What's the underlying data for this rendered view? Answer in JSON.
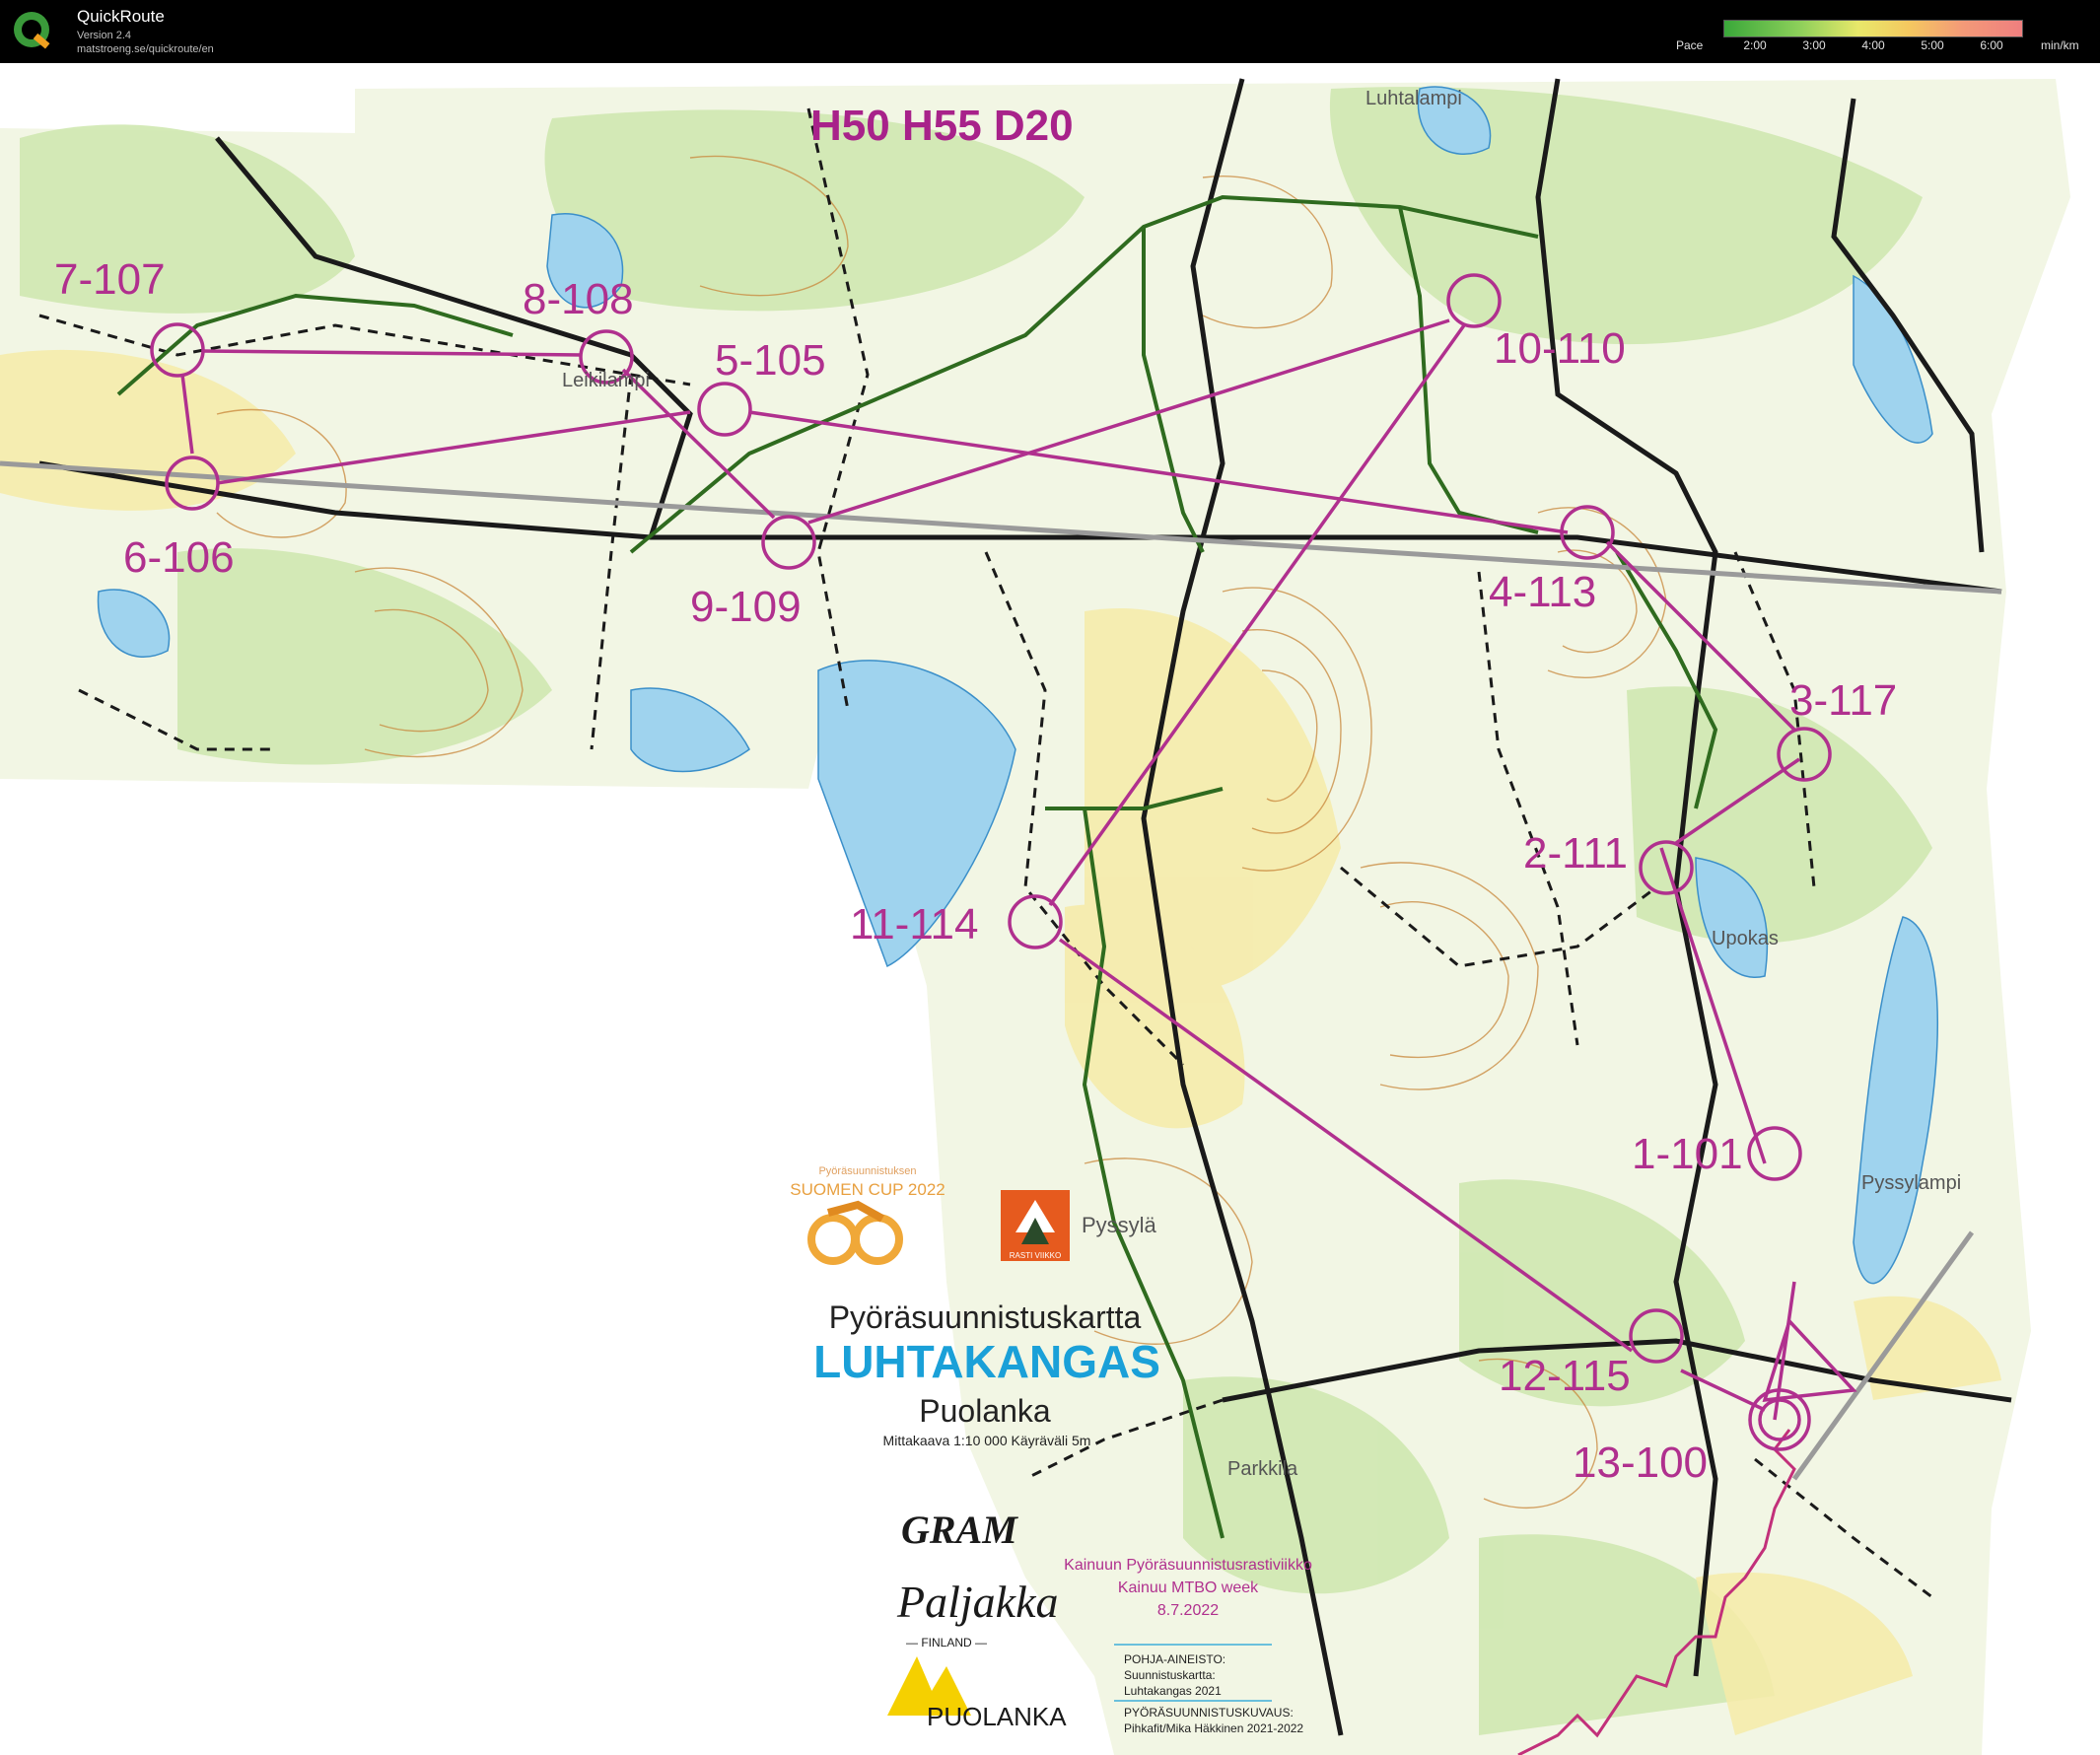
{
  "app": {
    "title": "QuickRoute",
    "version": "Version 2.4",
    "url": "matstroeng.se/quickroute/en"
  },
  "pace_legend": {
    "label": "Pace",
    "ticks": [
      "2:00",
      "3:00",
      "4:00",
      "5:00",
      "6:00"
    ],
    "unit": "min/km"
  },
  "map": {
    "course_title": "H50 H55 D20",
    "place_names": [
      "Luhtalampi",
      "Leikilampi",
      "Upokas",
      "Pyssylampi",
      "Parkkila",
      "Pyssylä"
    ],
    "controls": [
      {
        "label": "1-101"
      },
      {
        "label": "2-111"
      },
      {
        "label": "3-117"
      },
      {
        "label": "4-113"
      },
      {
        "label": "5-105"
      },
      {
        "label": "6-106"
      },
      {
        "label": "7-107"
      },
      {
        "label": "8-108"
      },
      {
        "label": "9-109"
      },
      {
        "label": "10-110"
      },
      {
        "label": "11-114"
      },
      {
        "label": "12-115"
      },
      {
        "label": "13-100"
      }
    ],
    "title_block": {
      "heading": "Pyöräsuunnistuskartta",
      "name": "LUHTAKANGAS",
      "municipality": "Puolanka",
      "scale": "Mittakaava 1:10 000   Käyräväli 5m"
    },
    "sponsors": {
      "cup_small": "Pyöräsuunnistuksen",
      "cup": "SUOMEN CUP 2022",
      "club": "Pyssylä",
      "rasti_viikko": "RASTI VIIKKO",
      "gram": "GRAM",
      "paljakka": "Paljakka",
      "finland": "— FINLAND —",
      "puolanka": "PUOLANKA"
    },
    "event": {
      "line1": "Kainuun Pyöräsuunnistusrastiviikko",
      "line2": "Kainuu MTBO week",
      "date": "8.7.2022"
    },
    "credits": {
      "line1": "POHJA-AINEISTO:",
      "line2": "Suunnistuskartta:",
      "line3": "Luhtakangas 2021",
      "line4": "PYÖRÄSUUNNISTUSKUVAUS:",
      "line5": "Pihkafit/Mika Häkkinen 2021-2022"
    },
    "colors": {
      "course": "#b0308e",
      "forest_green": "#cfe8b0",
      "open_yellow": "#f6eba8",
      "water": "#9fd3ee",
      "track_green": "#2f6b1f",
      "contour": "#c8863a",
      "route_red": "#c2307a",
      "title_blue": "#1aa0d8"
    }
  }
}
